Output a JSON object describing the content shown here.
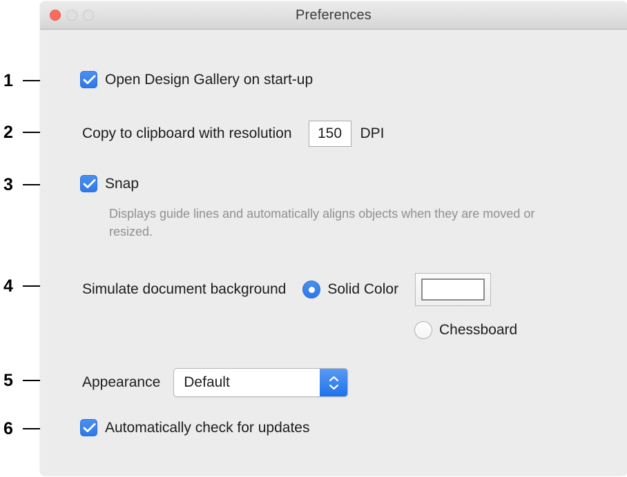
{
  "window": {
    "title": "Preferences",
    "traffic_lights": [
      {
        "name": "close",
        "color": "#fc6b5d"
      },
      {
        "name": "minimize",
        "color": "#e0e0e0"
      },
      {
        "name": "zoom",
        "color": "#e0e0e0"
      }
    ]
  },
  "colors": {
    "accent_blue": "#2f78e8",
    "window_bg": "#ececec",
    "titlebar_top": "#ebebeb",
    "titlebar_bottom": "#d4d4d4",
    "text": "#1c1c1c",
    "muted_text": "#909090",
    "close_red": "#fc6b5d",
    "swatch_color": "#ffffff"
  },
  "callouts": [
    {
      "number": "1"
    },
    {
      "number": "2"
    },
    {
      "number": "3"
    },
    {
      "number": "4"
    },
    {
      "number": "5"
    },
    {
      "number": "6"
    }
  ],
  "settings": {
    "open_gallery": {
      "label": "Open Design Gallery on start-up",
      "checked": true
    },
    "clipboard_resolution": {
      "label": "Copy to clipboard with resolution",
      "value": "150",
      "unit": "DPI"
    },
    "snap": {
      "label": "Snap",
      "checked": true,
      "description": "Displays guide lines and automatically aligns objects when they are moved or resized."
    },
    "simulate_background": {
      "label": "Simulate document background",
      "options": [
        {
          "label": "Solid Color",
          "selected": true
        },
        {
          "label": "Chessboard",
          "selected": false
        }
      ]
    },
    "appearance": {
      "label": "Appearance",
      "value": "Default"
    },
    "auto_update": {
      "label": "Automatically check for updates",
      "checked": true
    }
  }
}
